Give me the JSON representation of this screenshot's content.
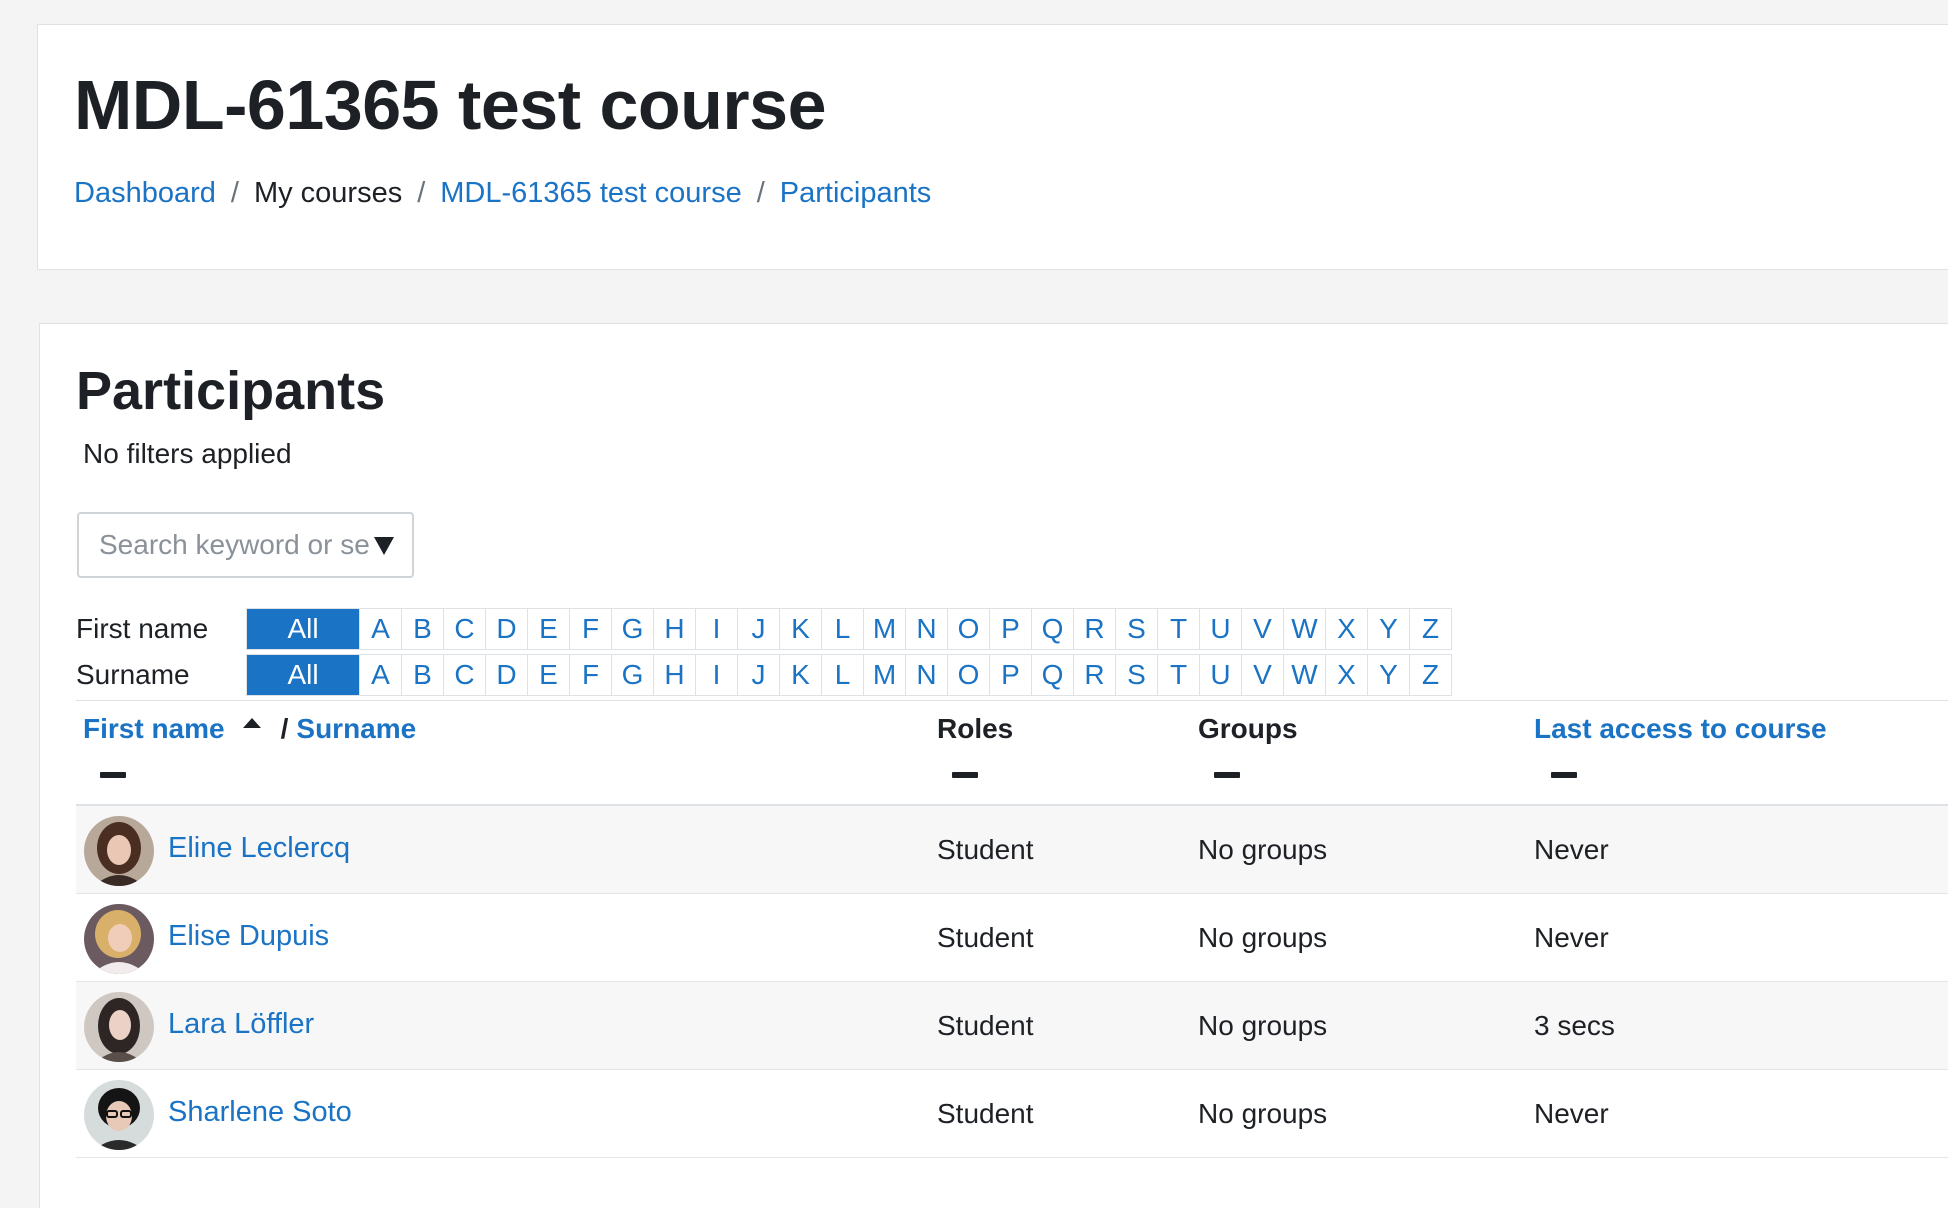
{
  "header": {
    "course_title": "MDL-61365 test course",
    "breadcrumb": [
      {
        "label": "Dashboard",
        "link": true
      },
      {
        "label": "My courses",
        "link": false
      },
      {
        "label": "MDL-61365 test course",
        "link": true
      },
      {
        "label": "Participants",
        "link": true
      }
    ],
    "breadcrumb_separator": "/"
  },
  "main": {
    "heading": "Participants",
    "filter_status": "No filters applied",
    "search": {
      "placeholder": "Search keyword or select filter",
      "value": ""
    },
    "initials": {
      "first_name_label": "First name",
      "surname_label": "Surname",
      "all_label": "All",
      "letters": [
        "A",
        "B",
        "C",
        "D",
        "E",
        "F",
        "G",
        "H",
        "I",
        "J",
        "K",
        "L",
        "M",
        "N",
        "O",
        "P",
        "Q",
        "R",
        "S",
        "T",
        "U",
        "V",
        "W",
        "X",
        "Y",
        "Z"
      ],
      "first_name_selected": "All",
      "surname_selected": "All"
    },
    "table": {
      "headers": {
        "first_name": "First name",
        "separator": "/",
        "surname": "Surname",
        "roles": "Roles",
        "groups": "Groups",
        "last_access": "Last access to course"
      },
      "rows": [
        {
          "name": "Eline Leclercq",
          "role": "Student",
          "groups": "No groups",
          "last_access": "Never"
        },
        {
          "name": "Elise Dupuis",
          "role": "Student",
          "groups": "No groups",
          "last_access": "Never"
        },
        {
          "name": "Lara Löffler",
          "role": "Student",
          "groups": "No groups",
          "last_access": "3 secs"
        },
        {
          "name": "Sharlene Soto",
          "role": "Student",
          "groups": "No groups",
          "last_access": "Never"
        }
      ]
    }
  },
  "colors": {
    "link": "#1a73c4",
    "text": "#1d2125",
    "page_bg": "#f4f4f4",
    "card_bg": "#ffffff",
    "active_initial_bg": "#1a73c4"
  },
  "icons": {
    "sort": "sort-asc-icon",
    "collapse": "collapse-icon",
    "dropdown": "caret-down-icon",
    "avatar": "user-avatar-photo"
  }
}
